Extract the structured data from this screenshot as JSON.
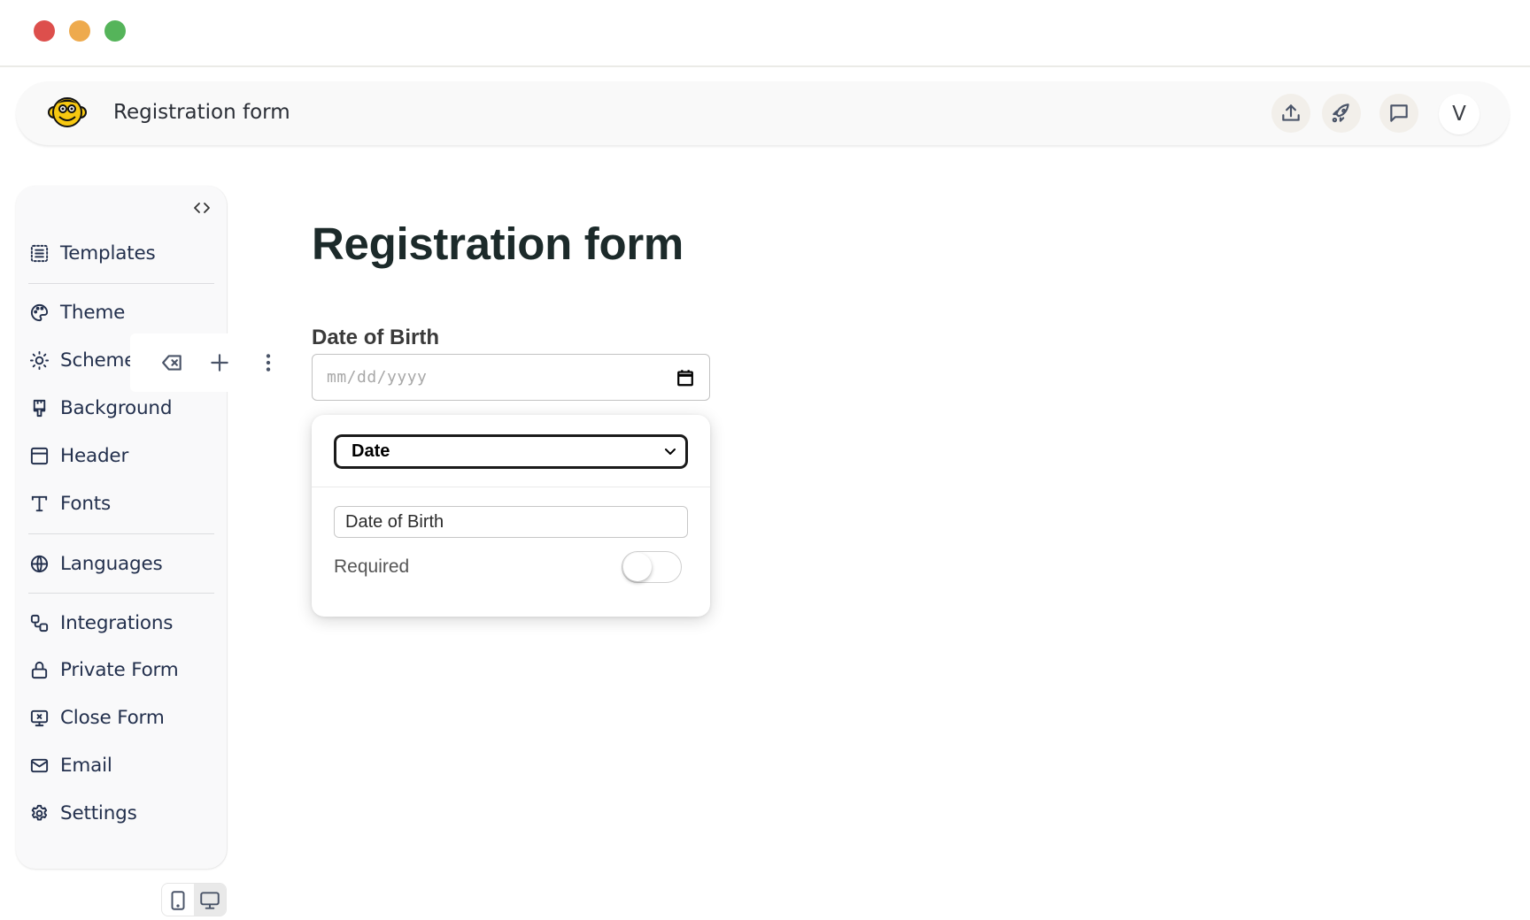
{
  "window": {
    "controls": [
      "close",
      "minimize",
      "maximize"
    ]
  },
  "header": {
    "logo_icon": "monkey-logo-icon",
    "title": "Registration form",
    "actions": [
      {
        "name": "share",
        "icon": "upload-icon"
      },
      {
        "name": "publish",
        "icon": "rocket-icon"
      },
      {
        "name": "feedback",
        "icon": "chat-icon"
      }
    ],
    "avatar_initial": "V"
  },
  "sidebar": {
    "collapse_icon": "code-brackets-icon",
    "items": [
      {
        "label": "Templates",
        "icon": "templates-icon"
      },
      {
        "label": "Theme",
        "icon": "palette-icon"
      },
      {
        "label": "Scheme",
        "icon": "sun-moon-icon"
      },
      {
        "label": "Background",
        "icon": "paintbrush-icon"
      },
      {
        "label": "Header",
        "icon": "layout-header-icon"
      },
      {
        "label": "Fonts",
        "icon": "type-icon"
      },
      {
        "label": "Languages",
        "icon": "globe-icon"
      },
      {
        "label": "Integrations",
        "icon": "integrations-icon"
      },
      {
        "label": "Private Form",
        "icon": "lock-icon"
      },
      {
        "label": "Close Form",
        "icon": "monitor-x-icon"
      },
      {
        "label": "Email",
        "icon": "mail-icon"
      },
      {
        "label": "Settings",
        "icon": "gear-icon"
      }
    ]
  },
  "field_toolbar": {
    "actions": [
      {
        "name": "delete-field",
        "icon": "backspace-x-icon"
      },
      {
        "name": "add-field",
        "icon": "plus-icon"
      },
      {
        "name": "more-options",
        "icon": "kebab-vertical-icon"
      }
    ]
  },
  "form": {
    "title": "Registration form",
    "fields": [
      {
        "label": "Date of Birth",
        "type": "date",
        "placeholder": "mm/dd/yyyy",
        "value": ""
      }
    ]
  },
  "field_editor": {
    "type_selected": "Date",
    "label_value": "Date of Birth",
    "required_label": "Required",
    "required": false
  },
  "device_toggle": {
    "options": [
      "mobile",
      "desktop"
    ],
    "active": "desktop"
  },
  "colors": {
    "close": "#dd4f4c",
    "minimize": "#eeaa4d",
    "maximize": "#55b45a",
    "sidebar_text": "#23304d",
    "title_text": "#1c2a2a"
  }
}
